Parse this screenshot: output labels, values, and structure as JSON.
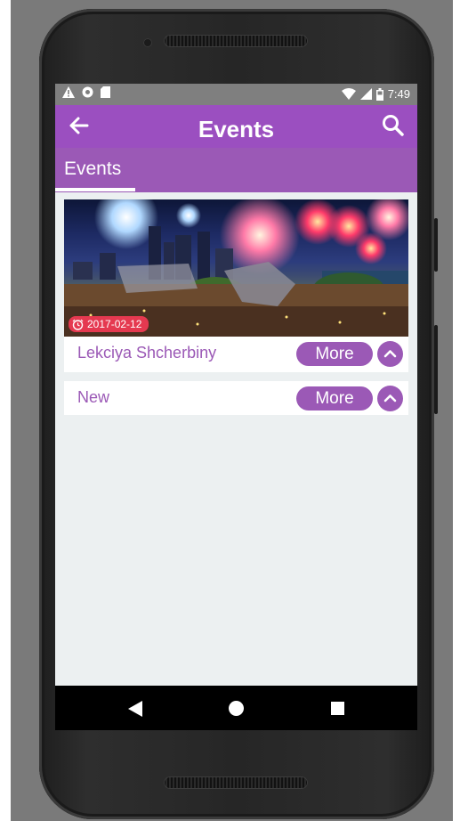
{
  "status_bar": {
    "time": "7:49",
    "left_icons": [
      "warning-icon",
      "circle-icon",
      "sd-card-icon"
    ],
    "right_icons": [
      "wifi-icon",
      "signal-icon",
      "battery-icon"
    ]
  },
  "app_bar": {
    "title": "Events",
    "back_icon": "arrow-left-icon",
    "search_icon": "search-icon"
  },
  "tabs": [
    {
      "label": "Events",
      "active": true
    }
  ],
  "events": [
    {
      "title": "Lekciya Shcherbiny",
      "date": "2017-02-12",
      "has_image": true,
      "more_label": "More",
      "chevron_icon": "chevron-up-icon"
    },
    {
      "title": "New",
      "has_image": false,
      "more_label": "More",
      "chevron_icon": "chevron-up-icon"
    }
  ],
  "nav_bar": {
    "icons": [
      "nav-back-icon",
      "nav-home-icon",
      "nav-recents-icon"
    ]
  },
  "colors": {
    "primary": "#9b59b6",
    "primary_dark": "#9b4fc0",
    "date_badge": "#e53950",
    "background": "#ecf0f1"
  }
}
